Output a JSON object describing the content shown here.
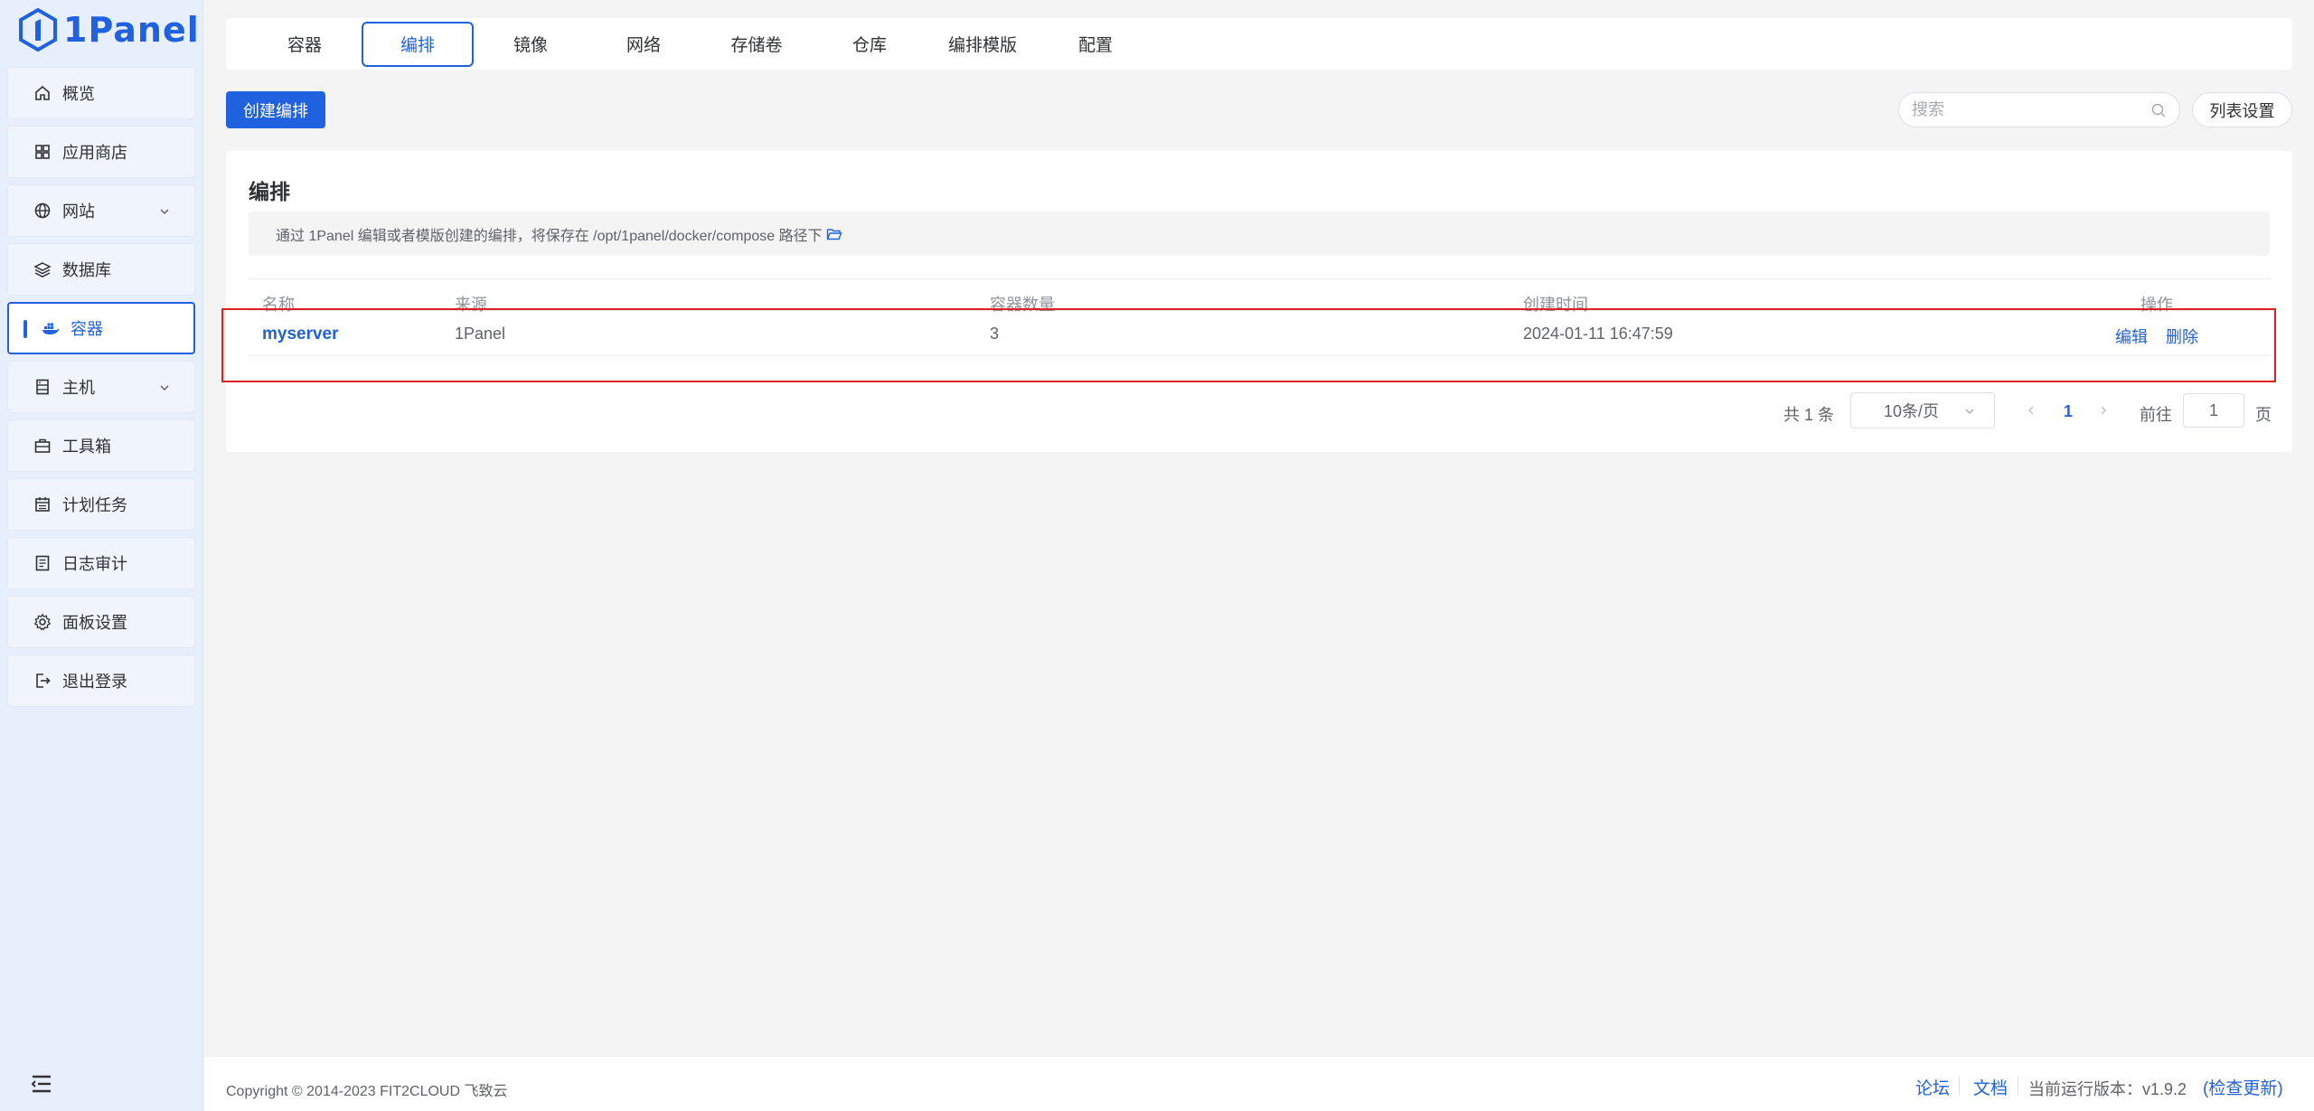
{
  "app": {
    "logo_text": "1Panel"
  },
  "sidebar": {
    "items": [
      {
        "label": "概览",
        "icon": "home-icon"
      },
      {
        "label": "应用商店",
        "icon": "grid-icon"
      },
      {
        "label": "网站",
        "icon": "globe-icon",
        "expandable": true
      },
      {
        "label": "数据库",
        "icon": "layers-icon"
      },
      {
        "label": "容器",
        "icon": "docker-icon",
        "active": true
      },
      {
        "label": "主机",
        "icon": "server-icon",
        "expandable": true
      },
      {
        "label": "工具箱",
        "icon": "toolbox-icon"
      },
      {
        "label": "计划任务",
        "icon": "calendar-icon"
      },
      {
        "label": "日志审计",
        "icon": "log-icon"
      },
      {
        "label": "面板设置",
        "icon": "gear-icon"
      },
      {
        "label": "退出登录",
        "icon": "logout-icon"
      }
    ]
  },
  "tabs": [
    {
      "label": "容器"
    },
    {
      "label": "编排",
      "active": true
    },
    {
      "label": "镜像"
    },
    {
      "label": "网络"
    },
    {
      "label": "存储卷"
    },
    {
      "label": "仓库"
    },
    {
      "label": "编排模版"
    },
    {
      "label": "配置"
    }
  ],
  "toolbar": {
    "create_label": "创建编排",
    "search_placeholder": "搜索",
    "list_settings_label": "列表设置"
  },
  "card": {
    "title": "编排",
    "notice": "通过 1Panel 编辑或者模版创建的编排，将保存在 /opt/1panel/docker/compose 路径下"
  },
  "table": {
    "headers": {
      "name": "名称",
      "source": "来源",
      "count": "容器数量",
      "created": "创建时间",
      "ops": "操作"
    },
    "rows": [
      {
        "name": "myserver",
        "source": "1Panel",
        "count": "3",
        "created": "2024-01-11 16:47:59",
        "edit": "编辑",
        "delete": "删除"
      }
    ]
  },
  "pagination": {
    "total": "共 1 条",
    "page_size": "10条/页",
    "current_page": "1",
    "goto_label": "前往",
    "goto_value": "1",
    "page_suffix": "页"
  },
  "footer": {
    "copyright": "Copyright © 2014-2023 FIT2CLOUD 飞致云",
    "forum": "论坛",
    "docs": "文档",
    "version_label": "当前运行版本：v1.9.2",
    "check_update": "(检查更新)"
  },
  "colors": {
    "primary": "#1f61df",
    "highlight": "#e02020",
    "sidebar_bg": "#e8effc"
  }
}
